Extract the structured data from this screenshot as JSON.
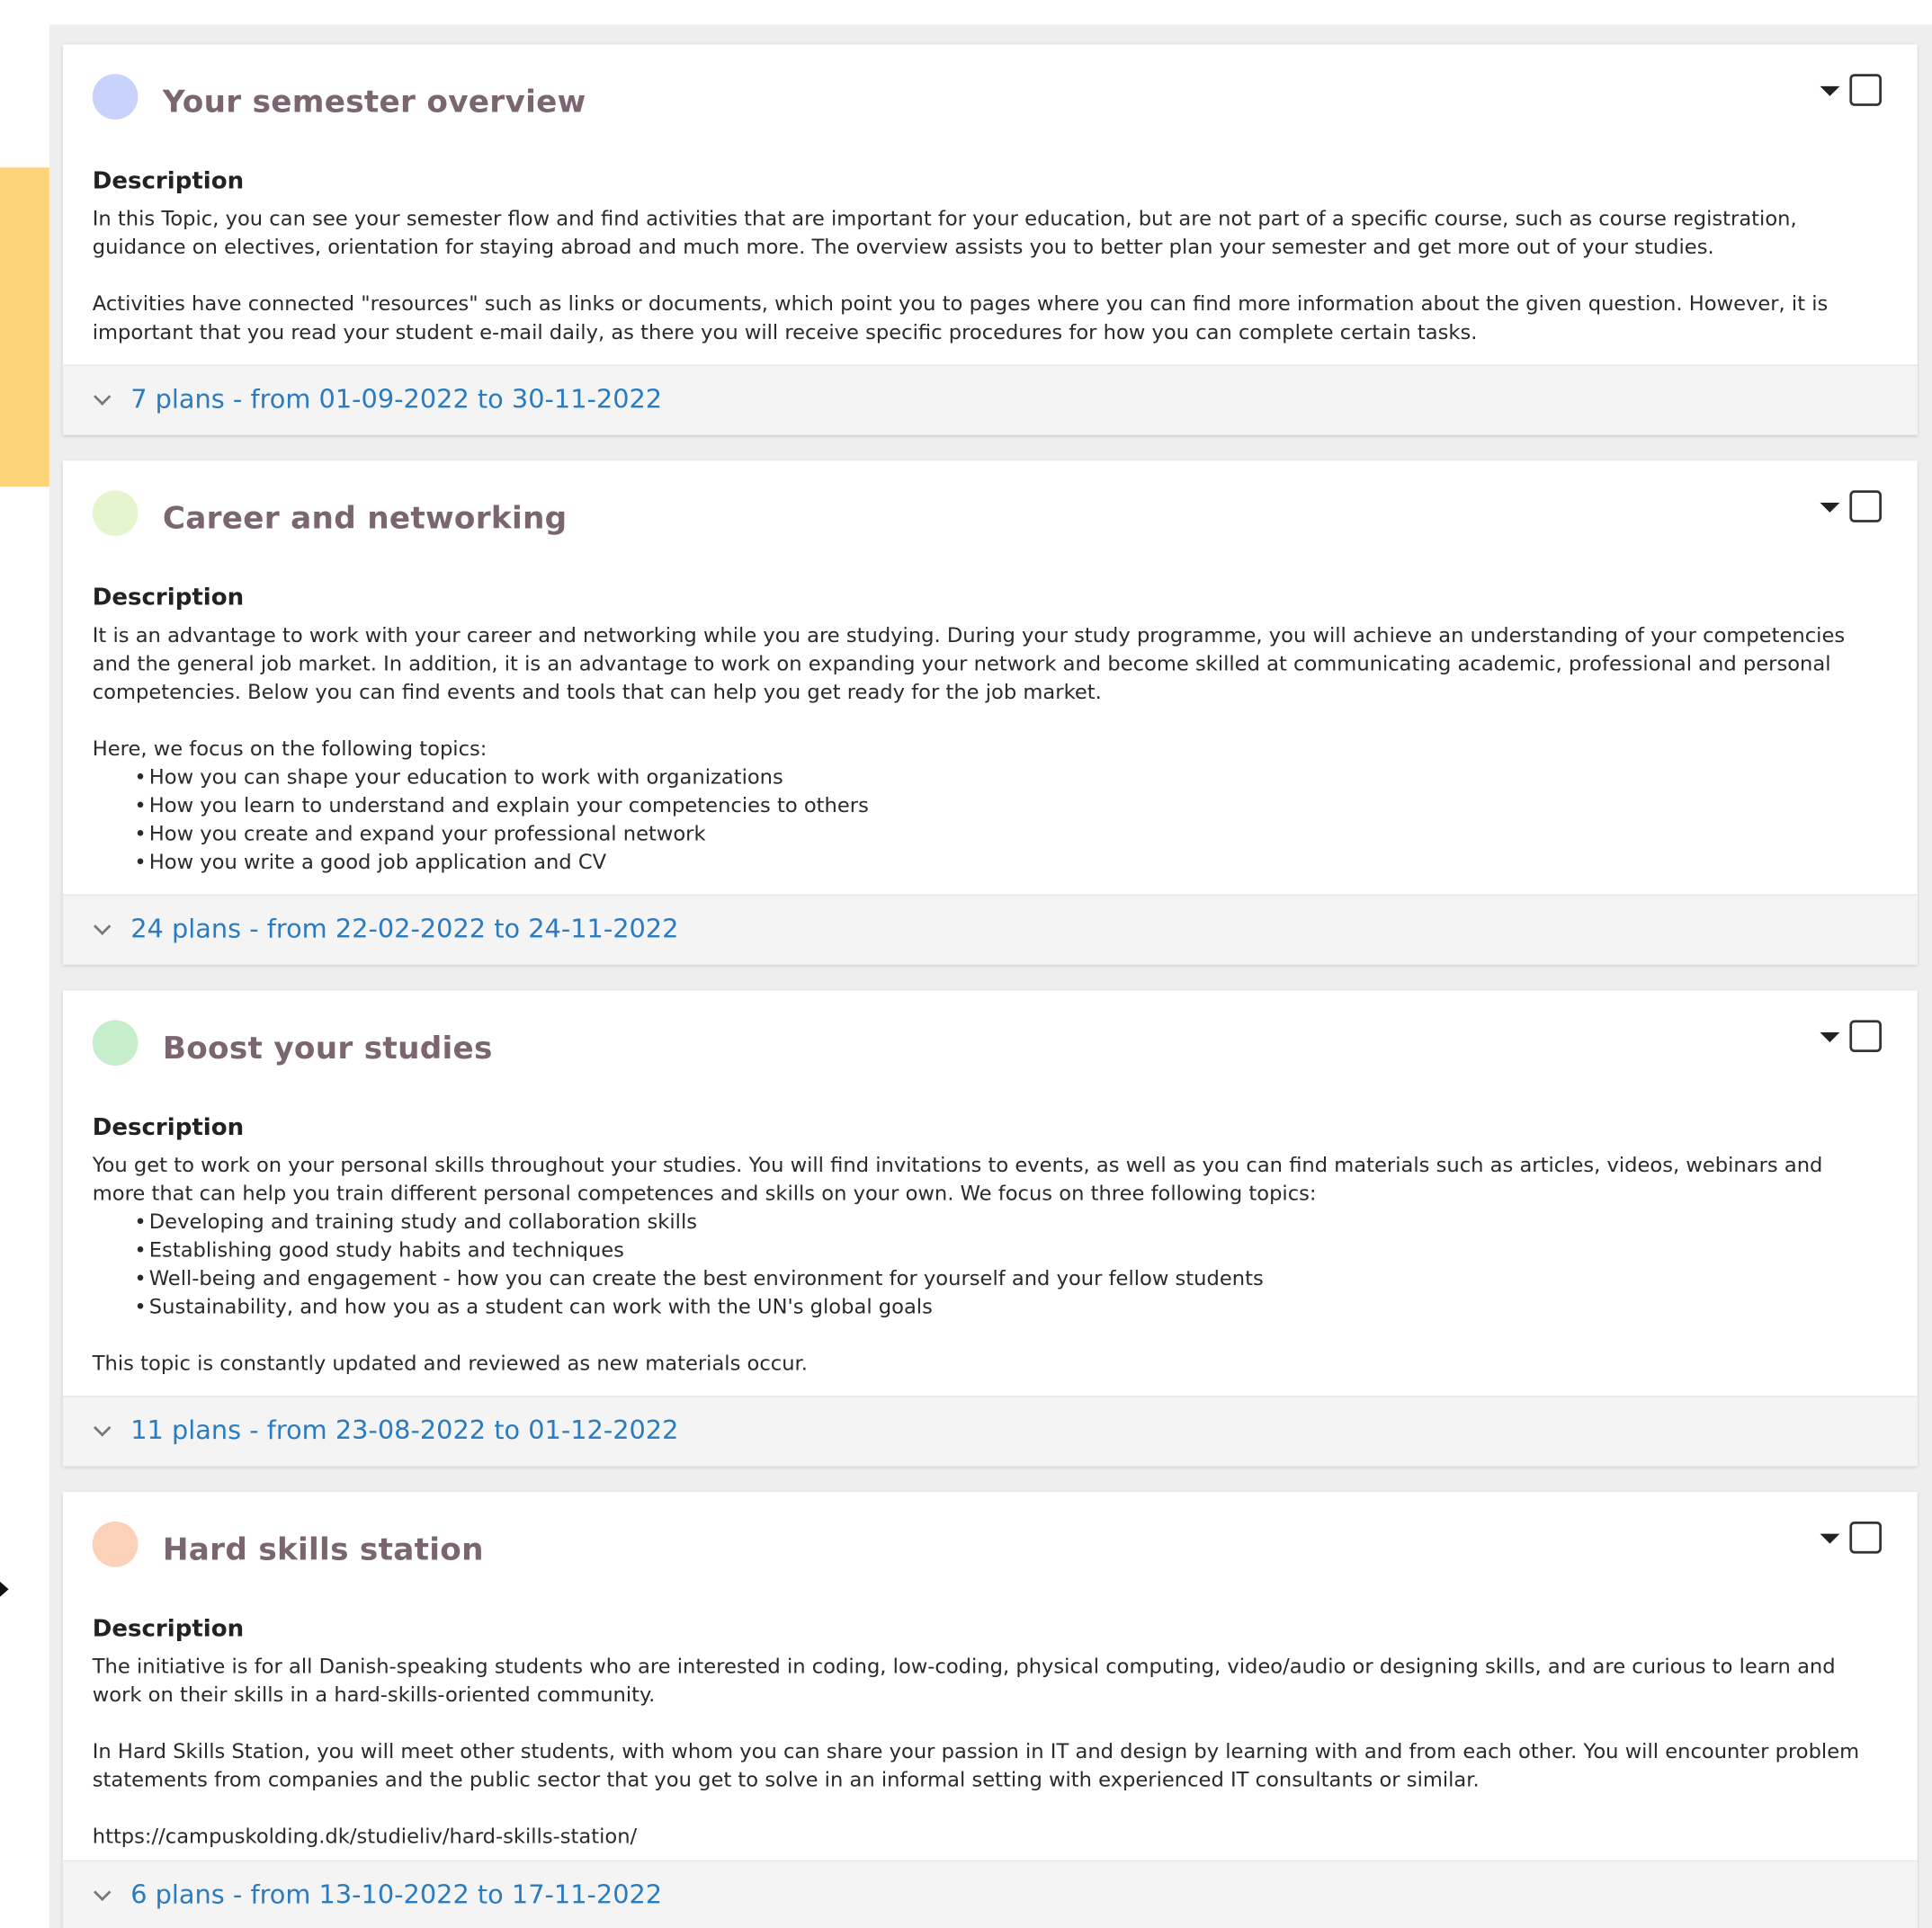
{
  "cards": [
    {
      "title": "Your semester overview",
      "dot_color": "#c9d2fb",
      "description_label": "Description",
      "paragraphs": [
        "In this Topic, you can see your semester flow and find activities that are important for your education, but are not part of a specific course, such as course registration, guidance on electives, orientation for staying abroad and much more. The overview assists you to better plan your semester and get more out of your studies.",
        "Activities have connected \"resources\" such as links or documents, which point you to pages where you can find more information about the given question. However, it is important that you read your student e-mail daily, as there you will receive specific procedures for how you can complete certain tasks."
      ],
      "plans_label": "7 plans - from 01-09-2022 to 30-11-2022"
    },
    {
      "title": "Career and networking",
      "dot_color": "#e5f6cf",
      "description_label": "Description",
      "paragraphs": [
        "It is an advantage to work with your career and networking while you are studying. During your study programme, you will achieve an understanding of your competencies and the general job market. In addition, it is an advantage to work on expanding your network and become skilled at communicating academic, professional and personal competencies. Below you can find events and tools that can help you get ready for the job market.",
        "Here, we focus on the following topics:"
      ],
      "bullets": [
        "How you can shape your education to work with organizations",
        "How you learn to understand and explain your competencies to others",
        "How you create and expand your professional network",
        "How you write a good job application and CV"
      ],
      "plans_label": "24 plans - from 22-02-2022 to 24-11-2022"
    },
    {
      "title": "Boost your studies",
      "dot_color": "#c6eecb",
      "description_label": "Description",
      "paragraphs": [
        "You get to work on your personal skills throughout your studies. You will find invitations to events, as well as you can find materials such as articles, videos, webinars and more that can help you train different personal competences and skills on your own. We focus on three following topics:",
        "This topic is constantly updated and reviewed as new materials occur."
      ],
      "bullets": [
        "Developing and training study and collaboration skills",
        "Establishing good study habits and techniques",
        "Well-being and engagement - how you can create the best environment for yourself and your fellow students",
        "Sustainability, and how you as a student can work with the UN's global goals"
      ],
      "plans_label": "11 plans - from 23-08-2022 to 01-12-2022"
    },
    {
      "title": "Hard skills station",
      "dot_color": "#fbd2b8",
      "description_label": "Description",
      "paragraphs": [
        "The initiative is for all Danish-speaking students who are interested in coding, low-coding, physical computing, video/audio or designing skills, and are curious to learn and work on their skills in a hard-skills-oriented community.",
        "In Hard Skills Station, you will meet other students, with whom you can share your passion in IT and design by learning with and from each other. You will encounter problem statements from companies and the public sector that you get to solve in an informal setting with experienced IT consultants or similar.",
        "https://campuskolding.dk/studieliv/hard-skills-station/"
      ],
      "plans_label": "6 plans - from 13-10-2022 to 17-11-2022"
    }
  ],
  "colors": {
    "accent_bar": "#fdd37a",
    "link_blue": "#2a7bc0",
    "title_mauve": "#7a6570"
  }
}
